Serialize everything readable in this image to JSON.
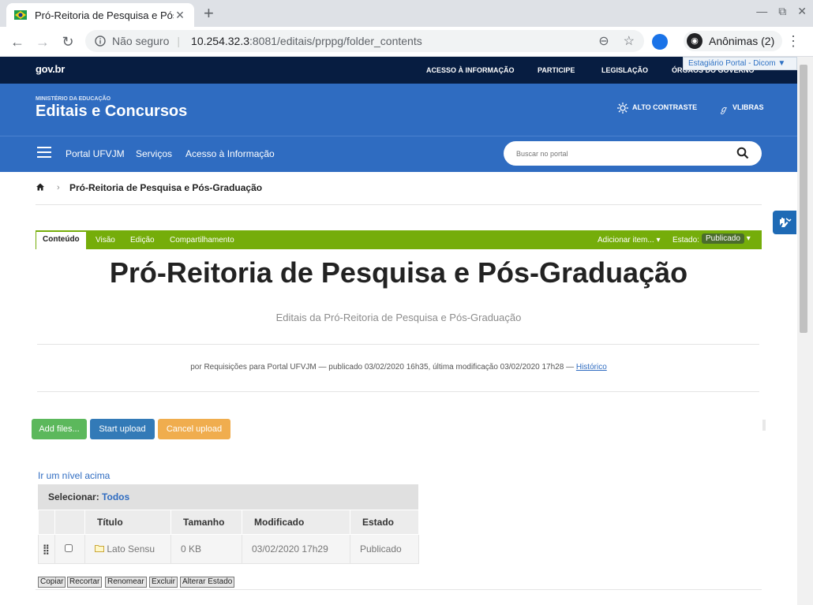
{
  "browser": {
    "tab_title": "Pró-Reitoria de Pesquisa e Pós-G",
    "insecure_label": "Não seguro",
    "url_host": "10.254.32.3",
    "url_rest": ":8081/editais/prppg/folder_contents",
    "profile_label": "Anônimas (2)"
  },
  "govbar": {
    "logo": "gov.br",
    "links": [
      "ACESSO À INFORMAÇÃO",
      "PARTICIPE",
      "LEGISLAÇÃO",
      "ÓRGÃOS DO GOVERNO"
    ],
    "user_menu": "Estagiário Portal - Dicom ▼"
  },
  "header": {
    "ministry": "MINISTÉRIO DA EDUCAÇÃO",
    "site_title": "Editais e Concursos",
    "alto_contraste": "ALTO CONTRASTE",
    "vlibras": "VLIBRAS",
    "nav": [
      "Portal UFVJM",
      "Serviços",
      "Acesso à Informação"
    ],
    "search_placeholder": "Buscar no portal"
  },
  "breadcrumb": {
    "current": "Pró-Reitoria de Pesquisa e Pós-Graduação"
  },
  "editbar": {
    "tabs": [
      "Conteúdo",
      "Visão",
      "Edição",
      "Compartilhamento"
    ],
    "add_item": "Adicionar item... ▾",
    "estado_label": "Estado:",
    "estado_value": "Publicado",
    "estado_caret": "▾"
  },
  "page": {
    "title": "Pró-Reitoria de Pesquisa e Pós-Graduação",
    "description": "Editais da Pró-Reitoria de Pesquisa e Pós-Graduação",
    "byline": "por Requisições para Portal UFVJM — publicado 03/02/2020 16h35, última modificação 03/02/2020 17h28 —",
    "byline_link": "Histórico"
  },
  "upload": {
    "add": "Add files...",
    "start": "Start upload",
    "cancel": "Cancel upload"
  },
  "folder": {
    "up_level": "Ir um nível acima",
    "select_label": "Selecionar:",
    "select_all": "Todos",
    "columns": [
      "Título",
      "Tamanho",
      "Modificado",
      "Estado"
    ],
    "rows": [
      {
        "title": "Lato Sensu",
        "size": "0 KB",
        "modified": "03/02/2020 17h29",
        "state": "Publicado"
      }
    ],
    "actions": [
      "Copiar",
      "Recortar",
      "Renomear",
      "Excluir",
      "Alterar Estado"
    ]
  }
}
